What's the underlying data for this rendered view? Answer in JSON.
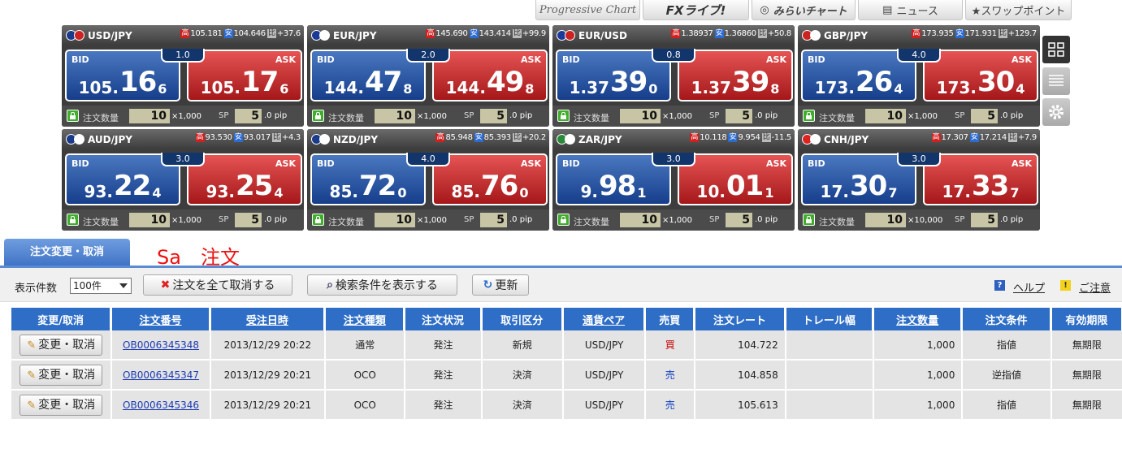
{
  "toolbar_top": {
    "progressive": "Progressive Chart",
    "fx_live": "FXライブ!",
    "mirai": "みらいチャート",
    "news": "ニュース",
    "swap": "★スワップポイント"
  },
  "panel_labels": {
    "bid": "BID",
    "ask": "ASK",
    "qty": "注文数量",
    "sp": "SP",
    "pip": "pip"
  },
  "panels": [
    {
      "pair": "USD/JPY",
      "hi": "105.181",
      "lo": "104.646",
      "chg": "+37.6",
      "spread": "1.0",
      "bid": [
        "105.",
        "16",
        "6"
      ],
      "ask": [
        "105.",
        "17",
        "6"
      ],
      "qty": "10",
      "mult": "×1,000",
      "sp": "5",
      "sp_dec": ".0",
      "flag1": "#1a3a8a",
      "flag2": "#c22"
    },
    {
      "pair": "EUR/JPY",
      "hi": "145.690",
      "lo": "143.414",
      "chg": "+99.9",
      "spread": "2.0",
      "bid": [
        "144.",
        "47",
        "8"
      ],
      "ask": [
        "144.",
        "49",
        "8"
      ],
      "qty": "10",
      "mult": "×1,000",
      "sp": "5",
      "sp_dec": ".0",
      "flag1": "#1a3a9a",
      "flag2": "#fff"
    },
    {
      "pair": "EUR/USD",
      "hi": "1.38937",
      "lo": "1.36860",
      "chg": "+50.8",
      "spread": "0.8",
      "bid": [
        "1.37",
        "39",
        "0"
      ],
      "ask": [
        "1.37",
        "39",
        "8"
      ],
      "qty": "10",
      "mult": "×1,000",
      "sp": "5",
      "sp_dec": ".0",
      "flag1": "#1a3a9a",
      "flag2": "#c22"
    },
    {
      "pair": "GBP/JPY",
      "hi": "173.935",
      "lo": "171.931",
      "chg": "+129.7",
      "spread": "4.0",
      "bid": [
        "173.",
        "26",
        "4"
      ],
      "ask": [
        "173.",
        "30",
        "4"
      ],
      "qty": "10",
      "mult": "×1,000",
      "sp": "5",
      "sp_dec": ".0",
      "flag1": "#c22",
      "flag2": "#fff"
    },
    {
      "pair": "AUD/JPY",
      "hi": "93.530",
      "lo": "93.017",
      "chg": "+4.3",
      "spread": "3.0",
      "bid": [
        "93.",
        "22",
        "4"
      ],
      "ask": [
        "93.",
        "25",
        "4"
      ],
      "qty": "10",
      "mult": "×1,000",
      "sp": "5",
      "sp_dec": ".0",
      "flag1": "#1a3a8a",
      "flag2": "#fff"
    },
    {
      "pair": "NZD/JPY",
      "hi": "85.948",
      "lo": "85.393",
      "chg": "+20.2",
      "spread": "4.0",
      "bid": [
        "85.",
        "72",
        "0"
      ],
      "ask": [
        "85.",
        "76",
        "0"
      ],
      "qty": "10",
      "mult": "×1,000",
      "sp": "5",
      "sp_dec": ".0",
      "flag1": "#1a3a8a",
      "flag2": "#fff"
    },
    {
      "pair": "ZAR/JPY",
      "hi": "10.118",
      "lo": "9.954",
      "chg": "-11.5",
      "spread": "3.0",
      "bid": [
        "9.",
        "98",
        "1"
      ],
      "ask": [
        "10.",
        "01",
        "1"
      ],
      "qty": "10",
      "mult": "×1,000",
      "sp": "5",
      "sp_dec": ".0",
      "flag1": "#2a8a3a",
      "flag2": "#fff"
    },
    {
      "pair": "CNH/JPY",
      "hi": "17.307",
      "lo": "17.214",
      "chg": "+7.9",
      "spread": "3.0",
      "bid": [
        "17.",
        "30",
        "7"
      ],
      "ask": [
        "17.",
        "33",
        "7"
      ],
      "qty": "10",
      "mult": "×10,000",
      "sp": "5",
      "sp_dec": ".0",
      "flag1": "#d22",
      "flag2": "#fff"
    }
  ],
  "tab": {
    "label": "注文変更・取消"
  },
  "annotation": "Sa　注文",
  "controls": {
    "count_label": "表示件数",
    "count_value": "100件",
    "cancel_all": "注文を全て取消する",
    "show_search": "検索条件を表示する",
    "refresh": "更新",
    "help": "ヘルプ",
    "caution": "ご注意"
  },
  "table": {
    "headers": [
      "変更/取消",
      "注文番号",
      "受注日時",
      "注文種類",
      "注文状況",
      "取引区分",
      "通貨ペア",
      "売買",
      "注文レート",
      "トレール幅",
      "注文数量",
      "注文条件",
      "有効期限"
    ],
    "edit_label": "変更・取消",
    "rows": [
      [
        "OB0006345348",
        "2013/12/29 20:22",
        "通常",
        "発注",
        "新規",
        "USD/JPY",
        "買",
        "104.722",
        "",
        "1,000",
        "指値",
        "無期限"
      ],
      [
        "OB0006345347",
        "2013/12/29 20:21",
        "OCO",
        "発注",
        "決済",
        "USD/JPY",
        "売",
        "104.858",
        "",
        "1,000",
        "逆指値",
        "無期限"
      ],
      [
        "OB0006345346",
        "2013/12/29 20:21",
        "OCO",
        "発注",
        "決済",
        "USD/JPY",
        "売",
        "105.613",
        "",
        "1,000",
        "指値",
        "無期限"
      ]
    ]
  },
  "colors": {
    "header_blue": "#2e6ec6",
    "bid_blue": "#163e8b",
    "ask_red": "#a5171a",
    "buy": "#c60000",
    "sell": "#1040c0"
  }
}
